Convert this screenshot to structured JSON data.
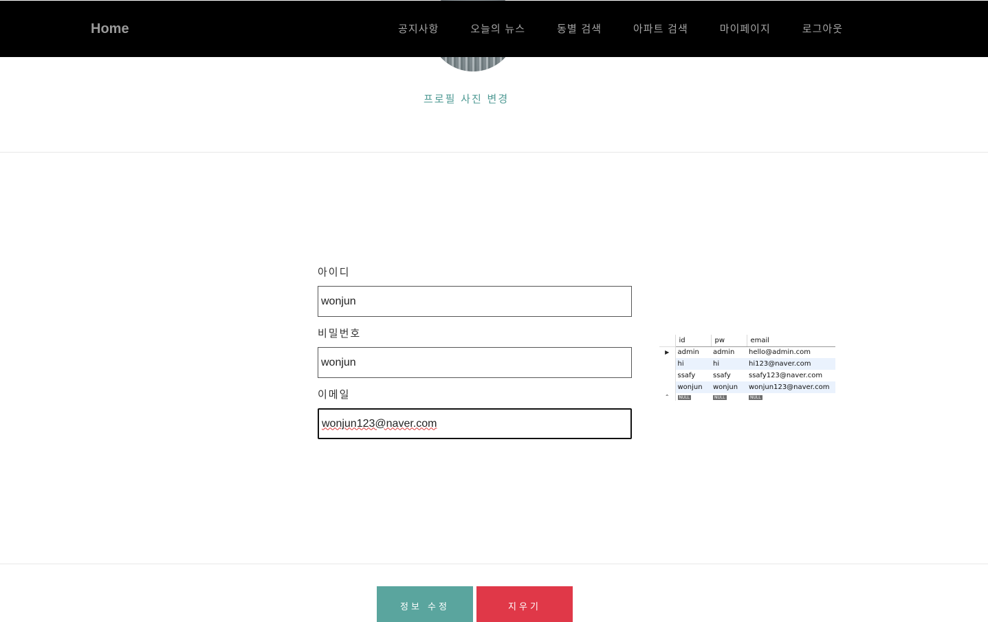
{
  "navbar": {
    "brand": "Home",
    "items": [
      "공지사항",
      "오늘의 뉴스",
      "동별 검색",
      "아파트 검색",
      "마이페이지",
      "로그아웃"
    ]
  },
  "profile": {
    "change_photo_label": "프로필 사진 변경"
  },
  "form": {
    "id_label": "아이디",
    "id_value": "wonjun",
    "pw_label": "비밀번호",
    "pw_value": "wonjun",
    "email_label": "이메일",
    "email_value": "wonjun123@naver.com"
  },
  "db_table": {
    "columns": [
      "id",
      "pw",
      "email"
    ],
    "rows": [
      [
        "admin",
        "admin",
        "hello@admin.com"
      ],
      [
        "hi",
        "hi",
        "hi123@naver.com"
      ],
      [
        "ssafy",
        "ssafy",
        "ssafy123@naver.com"
      ],
      [
        "wonjun",
        "wonjun",
        "wonjun123@naver.com"
      ]
    ],
    "null_label": "NULL"
  },
  "buttons": {
    "edit_label": "정보 수정",
    "clear_label": "지우기"
  },
  "colors": {
    "header_bg": "#000000",
    "accent_teal": "#5aa59e",
    "danger_red": "#e03848"
  }
}
